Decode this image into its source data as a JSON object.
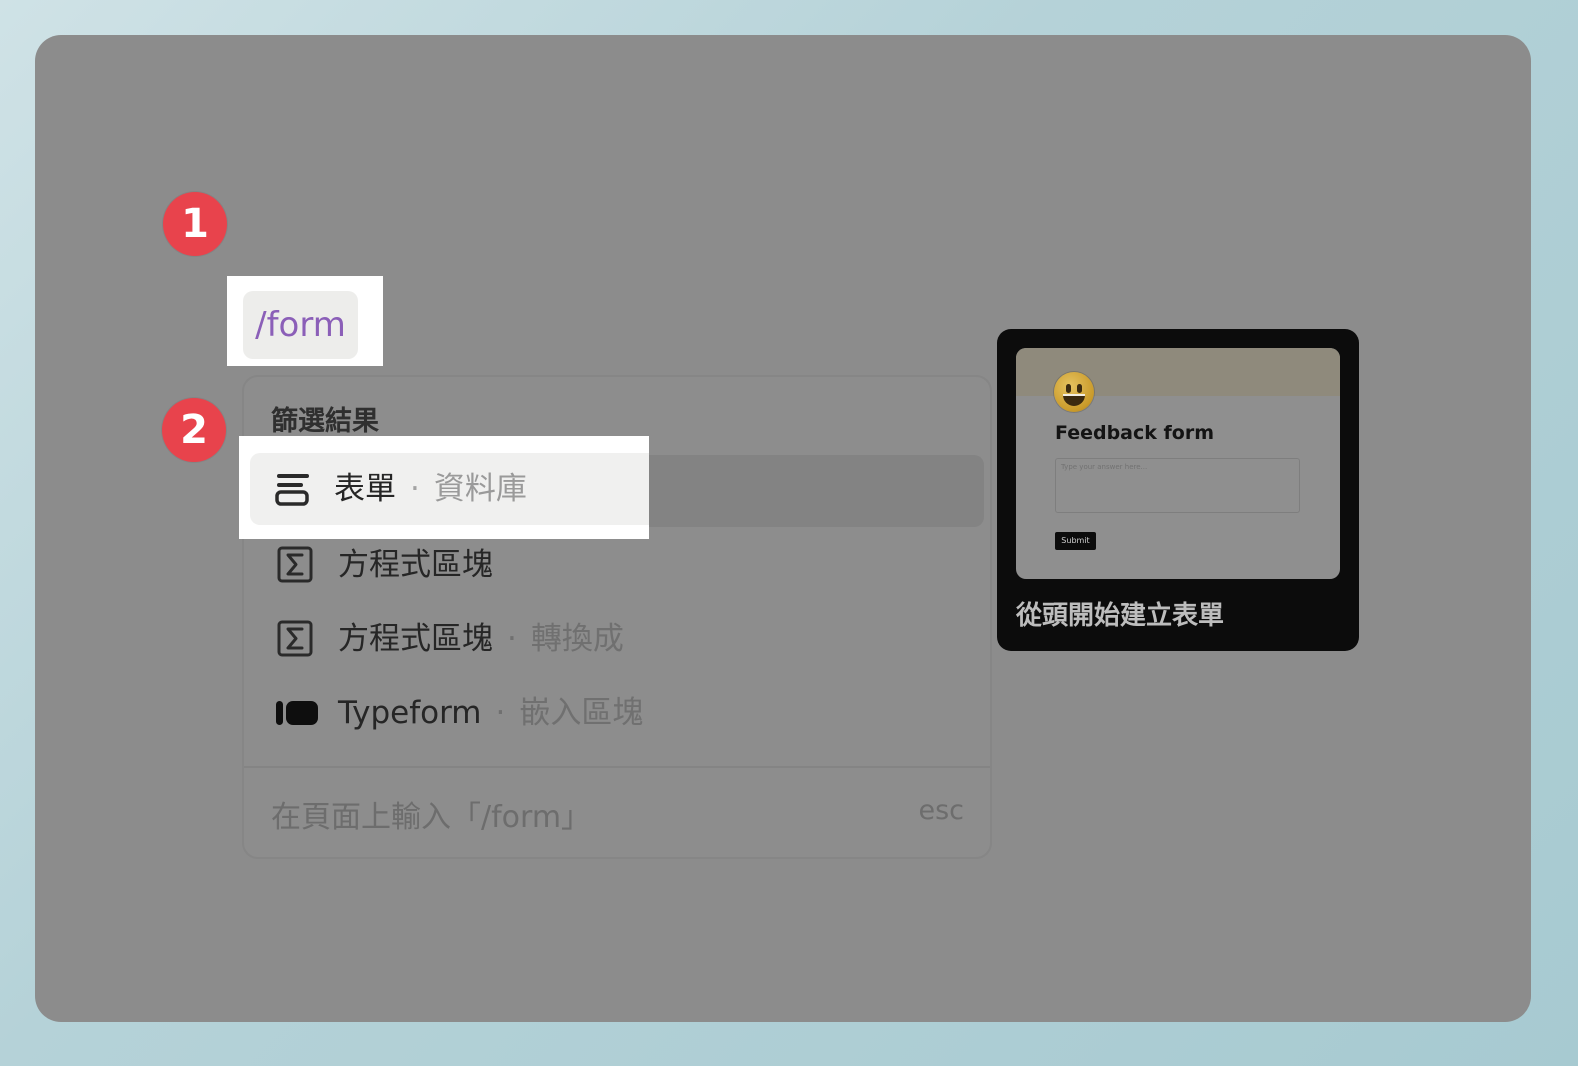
{
  "badges": {
    "step1": "1",
    "step2": "2"
  },
  "command": {
    "text": "/form"
  },
  "menu": {
    "header": "篩選結果",
    "items": [
      {
        "icon": "form-lines-icon",
        "label": "表單",
        "separator": "·",
        "sublabel": "資料庫",
        "selected": true
      },
      {
        "icon": "sigma-box-icon",
        "label": "方程式區塊",
        "separator": "",
        "sublabel": "",
        "selected": false
      },
      {
        "icon": "sigma-box-icon",
        "label": "方程式區塊",
        "separator": "·",
        "sublabel": "轉換成",
        "selected": false
      },
      {
        "icon": "typeform-logo-icon",
        "label": "Typeform",
        "separator": "·",
        "sublabel": "嵌入區塊",
        "selected": false
      }
    ],
    "footer": "在頁面上輸入「/form」",
    "esc": "esc"
  },
  "preview": {
    "thumb_title": "Feedback form",
    "thumb_placeholder": "Type your answer here...",
    "thumb_submit": "Submit",
    "caption": "從頭開始建立表單"
  },
  "colors": {
    "badge": "#e8434c",
    "command_text": "#8b5fb8",
    "overlay": "#8c8c8c"
  }
}
